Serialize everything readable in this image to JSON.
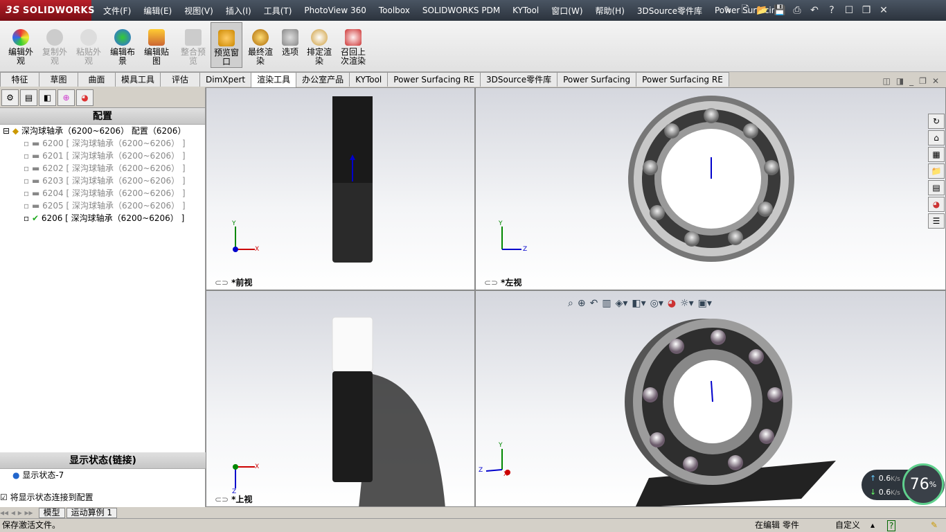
{
  "app": {
    "brand_ds": "3S",
    "brand": "SOLIDWORKS"
  },
  "menus": [
    "文件(F)",
    "编辑(E)",
    "视图(V)",
    "插入(I)",
    "工具(T)",
    "PhotoView 360",
    "Toolbox",
    "SOLIDWORKS PDM",
    "KYTool",
    "窗口(W)",
    "帮助(H)",
    "3DSource零件库",
    "Power Surfacing"
  ],
  "toolbar": [
    {
      "label": "编辑外观",
      "state": "normal"
    },
    {
      "label": "复制外观",
      "state": "disabled"
    },
    {
      "label": "粘贴外观",
      "state": "disabled"
    },
    {
      "label": "编辑布景",
      "state": "normal"
    },
    {
      "label": "编辑贴图",
      "state": "normal"
    },
    {
      "label": "整合预览",
      "state": "disabled"
    },
    {
      "label": "预览窗口",
      "state": "active"
    },
    {
      "label": "最终渲染",
      "state": "normal"
    },
    {
      "label": "选项",
      "state": "normal"
    },
    {
      "label": "排定渲染",
      "state": "normal"
    },
    {
      "label": "召回上次渲染",
      "state": "normal"
    }
  ],
  "tabs": [
    "特征",
    "草图",
    "曲面",
    "模具工具",
    "评估",
    "DimXpert",
    "渲染工具",
    "办公室产品",
    "KYTool",
    "Power Surfacing RE",
    "3DSource零件库",
    "Power Surfacing",
    "Power Surfacing RE"
  ],
  "selected_tab": "渲染工具",
  "panel": {
    "title": "配置",
    "root": "深沟球轴承（6200~6206） 配置（6206）",
    "configs": [
      {
        "name": "6200 [ 深沟球轴承（6200~6206） ]",
        "active": false
      },
      {
        "name": "6201 [ 深沟球轴承（6200~6206） ]",
        "active": false
      },
      {
        "name": "6202 [ 深沟球轴承（6200~6206） ]",
        "active": false
      },
      {
        "name": "6203 [ 深沟球轴承（6200~6206） ]",
        "active": false
      },
      {
        "name": "6204 [ 深沟球轴承（6200~6206） ]",
        "active": false
      },
      {
        "name": "6205 [ 深沟球轴承（6200~6206） ]",
        "active": false
      },
      {
        "name": "6206 [ 深沟球轴承（6200~6206） ]",
        "active": true
      }
    ],
    "display_state_title": "显示状态(链接)",
    "display_state": "显示状态-7",
    "link_checkbox": "将显示状态连接到配置"
  },
  "bottom_tabs": [
    "模型",
    "运动算例 1"
  ],
  "views": {
    "front": "*前视",
    "left": "*左视",
    "top": "*上视",
    "axes": {
      "x": "X",
      "y": "Y",
      "z": "Z"
    }
  },
  "status": {
    "left": "保存激活文件。",
    "editing": "在编辑 零件",
    "custom": "自定义"
  },
  "net": {
    "up": "0.6",
    "down": "0.6",
    "unit": "K/s",
    "percent": "76",
    "percent_sign": "%"
  },
  "colors": {
    "accent": "#b8202a",
    "gauge": "#5fd08d"
  }
}
